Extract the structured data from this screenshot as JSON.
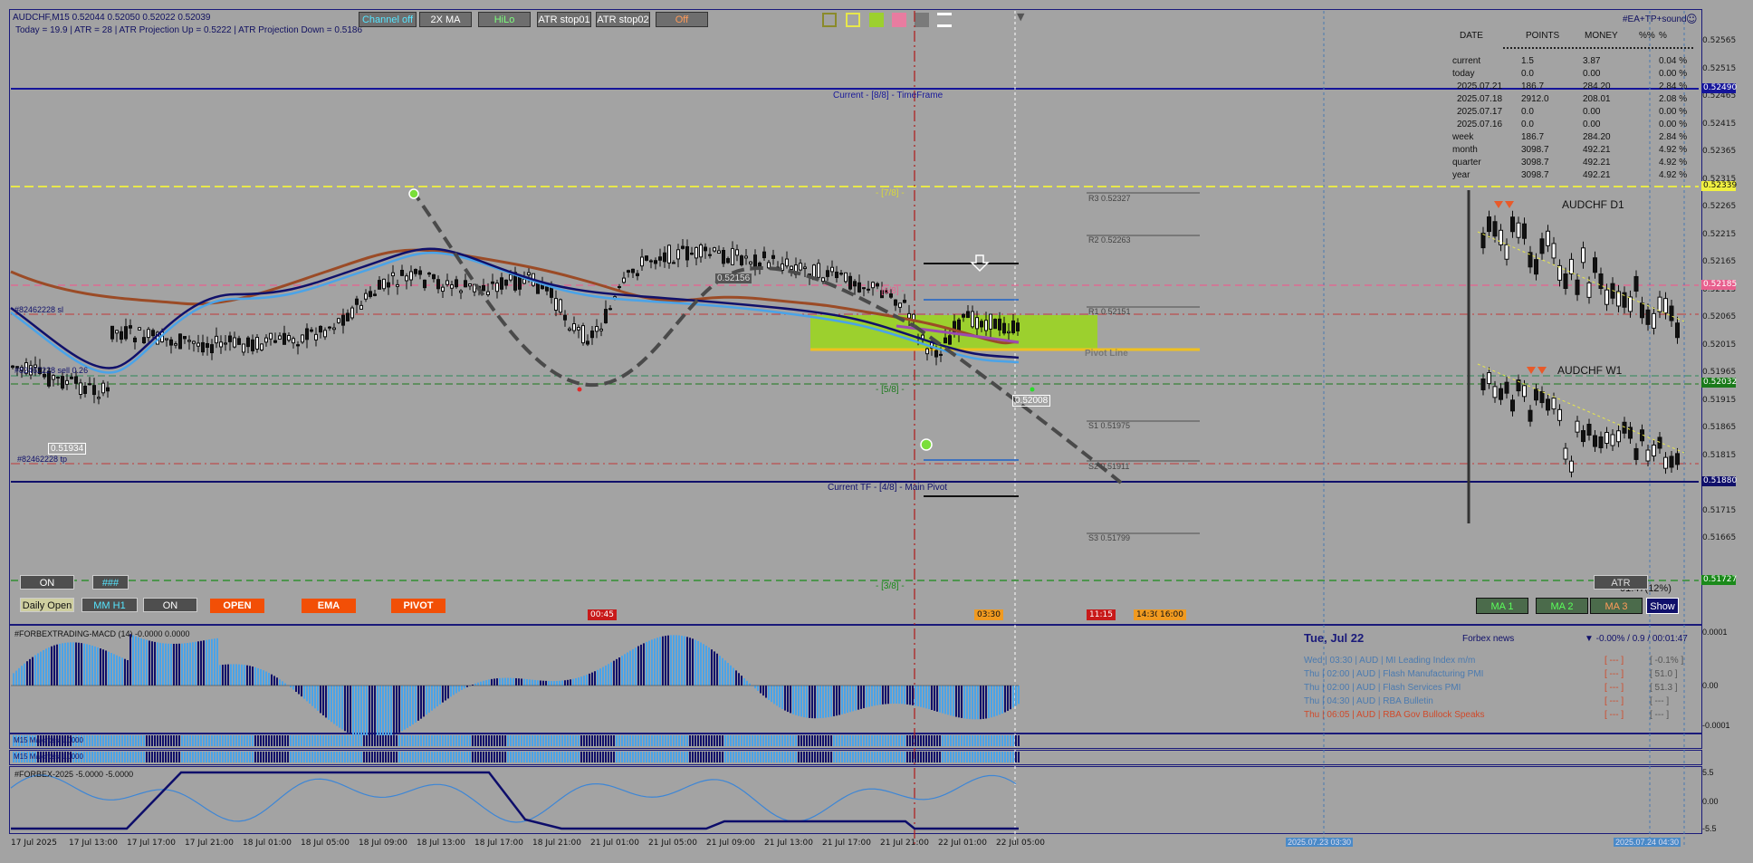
{
  "header": {
    "symbol_line": "AUDCHF,M15  0.52044 0.52050 0.52022 0.52039",
    "info_line": "Today = 19.9    |    ATR = 28    |    ATR Projection Up = 0.5222    |    ATR Projection Down = 0.5186",
    "top_right_tag": "#EA+TP+sound"
  },
  "toolbar": {
    "channel_off": "Channel off",
    "two_x_ma": "2X MA",
    "hilo": "HiLo",
    "atr_stop01": "ATR stop01",
    "atr_stop02": "ATR stop02",
    "off": "Off"
  },
  "stats": {
    "headers": [
      "DATE",
      "POINTS",
      "MONEY",
      "%%",
      "%"
    ],
    "rows": [
      {
        "label": "current",
        "points": "1.5",
        "money": "3.87",
        "pct": "0.04 %"
      },
      {
        "label": "today",
        "points": "0.0",
        "money": "0.00",
        "pct": "0.00 %"
      },
      {
        "label": "2025.07.21",
        "points": "186.7",
        "money": "284.20",
        "pct": "2.84 %"
      },
      {
        "label": "2025.07.18",
        "points": "2912.0",
        "money": "208.01",
        "pct": "2.08 %"
      },
      {
        "label": "2025.07.17",
        "points": "0.0",
        "money": "0.00",
        "pct": "0.00 %"
      },
      {
        "label": "2025.07.16",
        "points": "0.0",
        "money": "0.00",
        "pct": "0.00 %"
      },
      {
        "label": "week",
        "points": "186.7",
        "money": "284.20",
        "pct": "2.84 %"
      },
      {
        "label": "month",
        "points": "3098.7",
        "money": "492.21",
        "pct": "4.92 %"
      },
      {
        "label": "quarter",
        "points": "3098.7",
        "money": "492.21",
        "pct": "4.92 %"
      },
      {
        "label": "year",
        "points": "3098.7",
        "money": "492.21",
        "pct": "4.92 %"
      }
    ]
  },
  "chart_labels": {
    "current_tf": "Current - [8/8] - TimeFrame",
    "seven_eighths": "- [7/8] -",
    "six_eighths": "- [6/8] -",
    "five_eighths": "- [5/8] -",
    "main_pivot": "Current TF - [4/8] - Main Pivot",
    "three_eighths": "- [3/8] -",
    "pivot_line": "Pivot Line",
    "r3": "R3 0.52327",
    "r2": "R2 0.52263",
    "r1": "R1 0.52151",
    "s1": "S1 0.51975",
    "s2": "S2 0.51911",
    "s3": "S3 0.51799",
    "order_sl": "#82462228 sl",
    "order_sell": "#82462228 sell 0.26",
    "order_tp": "#82462228 tp",
    "low_price": "0.51934",
    "high_price": "0.52156",
    "current_price": "0.52008",
    "d1_title": "AUDCHF  D1",
    "w1_title": "AUDCHF  W1",
    "timer": "01:47(12%)"
  },
  "bottom_buttons": {
    "on_1": "ON",
    "hash": "###",
    "daily_open": "Daily Open",
    "mm_h1": "MM H1",
    "on_2": "ON",
    "open": "OPEN",
    "ema": "EMA",
    "pivot": "PIVOT",
    "atr": "ATR",
    "ma1": "MA 1",
    "ma2": "MA 2",
    "ma3": "MA 3",
    "show": "Show"
  },
  "event_markers": [
    "00:45",
    "03:30",
    "11:15",
    "14:30",
    "16:00"
  ],
  "news": {
    "date": "Tue, Jul 22",
    "source": "Forbex news",
    "status": "▼ -0.00% / 0.9 / 00:01:47",
    "items": [
      {
        "text": "Wed  |  03:30  |  AUD  |  MI Leading Index m/m",
        "impact": "[ --- ]",
        "value": "[ -0.1% ]"
      },
      {
        "text": "Thu  |  02:00  |  AUD  |  Flash Manufacturing PMI",
        "impact": "[ --- ]",
        "value": "[ 51.0 ]"
      },
      {
        "text": "Thu  |  02:00  |  AUD  |  Flash Services PMI",
        "impact": "[ --- ]",
        "value": "[ 51.3 ]"
      },
      {
        "text": "Thu  |  04:30  |  AUD  |  RBA Bulletin",
        "impact": "[ --- ]",
        "value": "[ --- ]"
      },
      {
        "text": "Thu  |  06:05  |  AUD  |  RBA Gov Bullock Speaks",
        "impact": "[ --- ]",
        "value": "[ --- ]"
      }
    ]
  },
  "indicators": {
    "macd": "#FORBEXTRADING-MACD (14) -0.0000 0.0000",
    "ma_cross_1": "M15 Ma cross 1.0000",
    "ma_cross_2": "M15 Ma cross 1.0000",
    "forbex": "#FORBEX-2025 -5.0000 -5.0000"
  },
  "price_axis": [
    "0.52565",
    "0.52515",
    "0.52465",
    "0.52415",
    "0.52365",
    "0.52315",
    "0.52265",
    "0.52215",
    "0.52165",
    "0.52115",
    "0.52065",
    "0.52015",
    "0.51965",
    "0.51915",
    "0.51865",
    "0.51815",
    "0.51765",
    "0.51715",
    "0.51665"
  ],
  "price_tags": {
    "top": "0.52490",
    "yellow": "0.52339",
    "pink": "0.52185",
    "green": "0.52032",
    "main": "0.51880",
    "bottom_green": "0.51727"
  },
  "macd_axis": [
    "0.0001",
    "0.00",
    "-0.0001"
  ],
  "forbex_axis": [
    "5.5",
    "0.00",
    "-5.5"
  ],
  "time_axis": [
    "17 Jul 2025",
    "17 Jul 13:00",
    "17 Jul 17:00",
    "17 Jul 21:00",
    "18 Jul 01:00",
    "18 Jul 05:00",
    "18 Jul 09:00",
    "18 Jul 13:00",
    "18 Jul 17:00",
    "18 Jul 21:00",
    "21 Jul 01:00",
    "21 Jul 05:00",
    "21 Jul 09:00",
    "21 Jul 13:00",
    "21 Jul 17:00",
    "21 Jul 21:00",
    "22 Jul 01:00",
    "22 Jul 05:00"
  ],
  "time_tags": {
    "t1": "2025.07.23 03:30",
    "t2": "2025.07.24 04:30"
  },
  "colors": {
    "background": "#a3a3a3",
    "accent_orange": "#f24f06",
    "dark_blue": "#101078",
    "light_blue": "#4aa3e8",
    "lime": "#9cd02e"
  }
}
